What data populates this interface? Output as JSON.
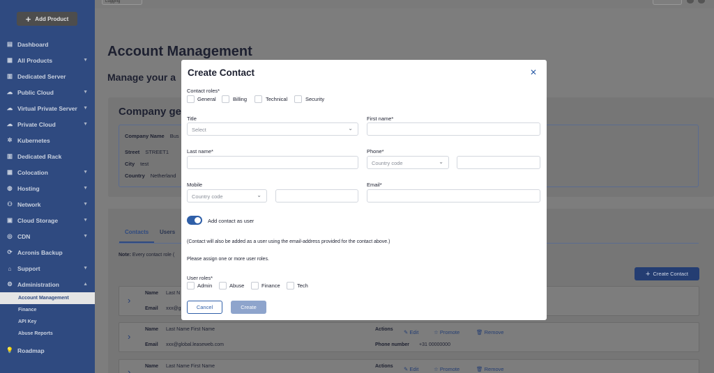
{
  "sidebar": {
    "add_product": "Add Product",
    "items": [
      {
        "label": "Dashboard",
        "icon": "dashboard-icon",
        "chevron": ""
      },
      {
        "label": "All Products",
        "icon": "grid-icon",
        "chevron": "▼"
      },
      {
        "label": "Dedicated Server",
        "icon": "server-icon",
        "chevron": ""
      },
      {
        "label": "Public Cloud",
        "icon": "cloud-icon",
        "chevron": "▼"
      },
      {
        "label": "Virtual Private Server",
        "icon": "cloud-icon",
        "chevron": "▼"
      },
      {
        "label": "Private Cloud",
        "icon": "cloud-icon",
        "chevron": "▼"
      },
      {
        "label": "Kubernetes",
        "icon": "kubernetes-icon",
        "chevron": ""
      },
      {
        "label": "Dedicated Rack",
        "icon": "rack-icon",
        "chevron": ""
      },
      {
        "label": "Colocation",
        "icon": "colocation-icon",
        "chevron": "▼"
      },
      {
        "label": "Hosting",
        "icon": "globe-icon",
        "chevron": "▼"
      },
      {
        "label": "Network",
        "icon": "network-icon",
        "chevron": "▼"
      },
      {
        "label": "Cloud Storage",
        "icon": "storage-icon",
        "chevron": "▼"
      },
      {
        "label": "CDN",
        "icon": "cdn-icon",
        "chevron": "▼"
      },
      {
        "label": "Acronis Backup",
        "icon": "backup-icon",
        "chevron": ""
      },
      {
        "label": "Support",
        "icon": "support-icon",
        "chevron": "▼"
      },
      {
        "label": "Administration",
        "icon": "gear-icon",
        "chevron": "▲"
      }
    ],
    "sub_items": [
      "Account Management",
      "Finance",
      "API Key",
      "Abuse Reports"
    ],
    "roadmap": "Roadmap"
  },
  "topbar": {
    "select_value": "Lugging"
  },
  "page": {
    "title": "Account Management",
    "subtitle": "Manage your a",
    "company_title": "Company ge",
    "company": {
      "name_label": "Company Name",
      "name_value": "Bus",
      "street_label": "Street",
      "street_value": "STREET1",
      "city_label": "City",
      "city_value": "test",
      "country_label": "Country",
      "country_value": "Netherland"
    }
  },
  "contacts": {
    "tabs": [
      "Contacts",
      "Users"
    ],
    "note_label": "Note:",
    "note_text": "Every contact role (",
    "create_contact": "Create Contact",
    "rows": [
      {
        "name_label": "Name",
        "name": "Last N",
        "email_label": "Email",
        "email": "xxx@gl",
        "actions_label": "",
        "phone_label": "",
        "phone": ""
      },
      {
        "name_label": "Name",
        "name": "Last Name First Name",
        "email_label": "Email",
        "email": "xxx@global.leaseweb.com",
        "actions_label": "Actions",
        "phone_label": "Phone number",
        "phone": "+31 00000000"
      },
      {
        "name_label": "Name",
        "name": "Last Name First Name",
        "email_label": "",
        "email": "",
        "actions_label": "Actions",
        "phone_label": "",
        "phone": ""
      }
    ],
    "actions": {
      "edit": "Edit",
      "promote": "Promote",
      "remove": "Remove"
    }
  },
  "modal": {
    "title": "Create Contact",
    "contact_roles_label": "Contact roles*",
    "contact_roles": [
      "General",
      "Billing",
      "Technical",
      "Security"
    ],
    "title_label": "Title",
    "title_placeholder": "Select",
    "first_name_label": "First name*",
    "last_name_label": "Last name*",
    "phone_label": "Phone*",
    "country_code_placeholder": "Country code",
    "mobile_label": "Mobile",
    "email_label": "Email*",
    "add_as_user_label": "Add contact as user",
    "add_as_user_on": true,
    "info_text": "(Contact will also be added as a user using the email-address provided for the contact above.)",
    "assign_text": "Please assign one or more user roles.",
    "user_roles_label": "User roles*",
    "user_roles": [
      "Admin",
      "Abuse",
      "Finance",
      "Tech"
    ],
    "cancel": "Cancel",
    "create": "Create"
  },
  "colors": {
    "sidebar": "#2f4a80",
    "accent": "#2f5fa8",
    "overlay": "#7d7d7d"
  }
}
